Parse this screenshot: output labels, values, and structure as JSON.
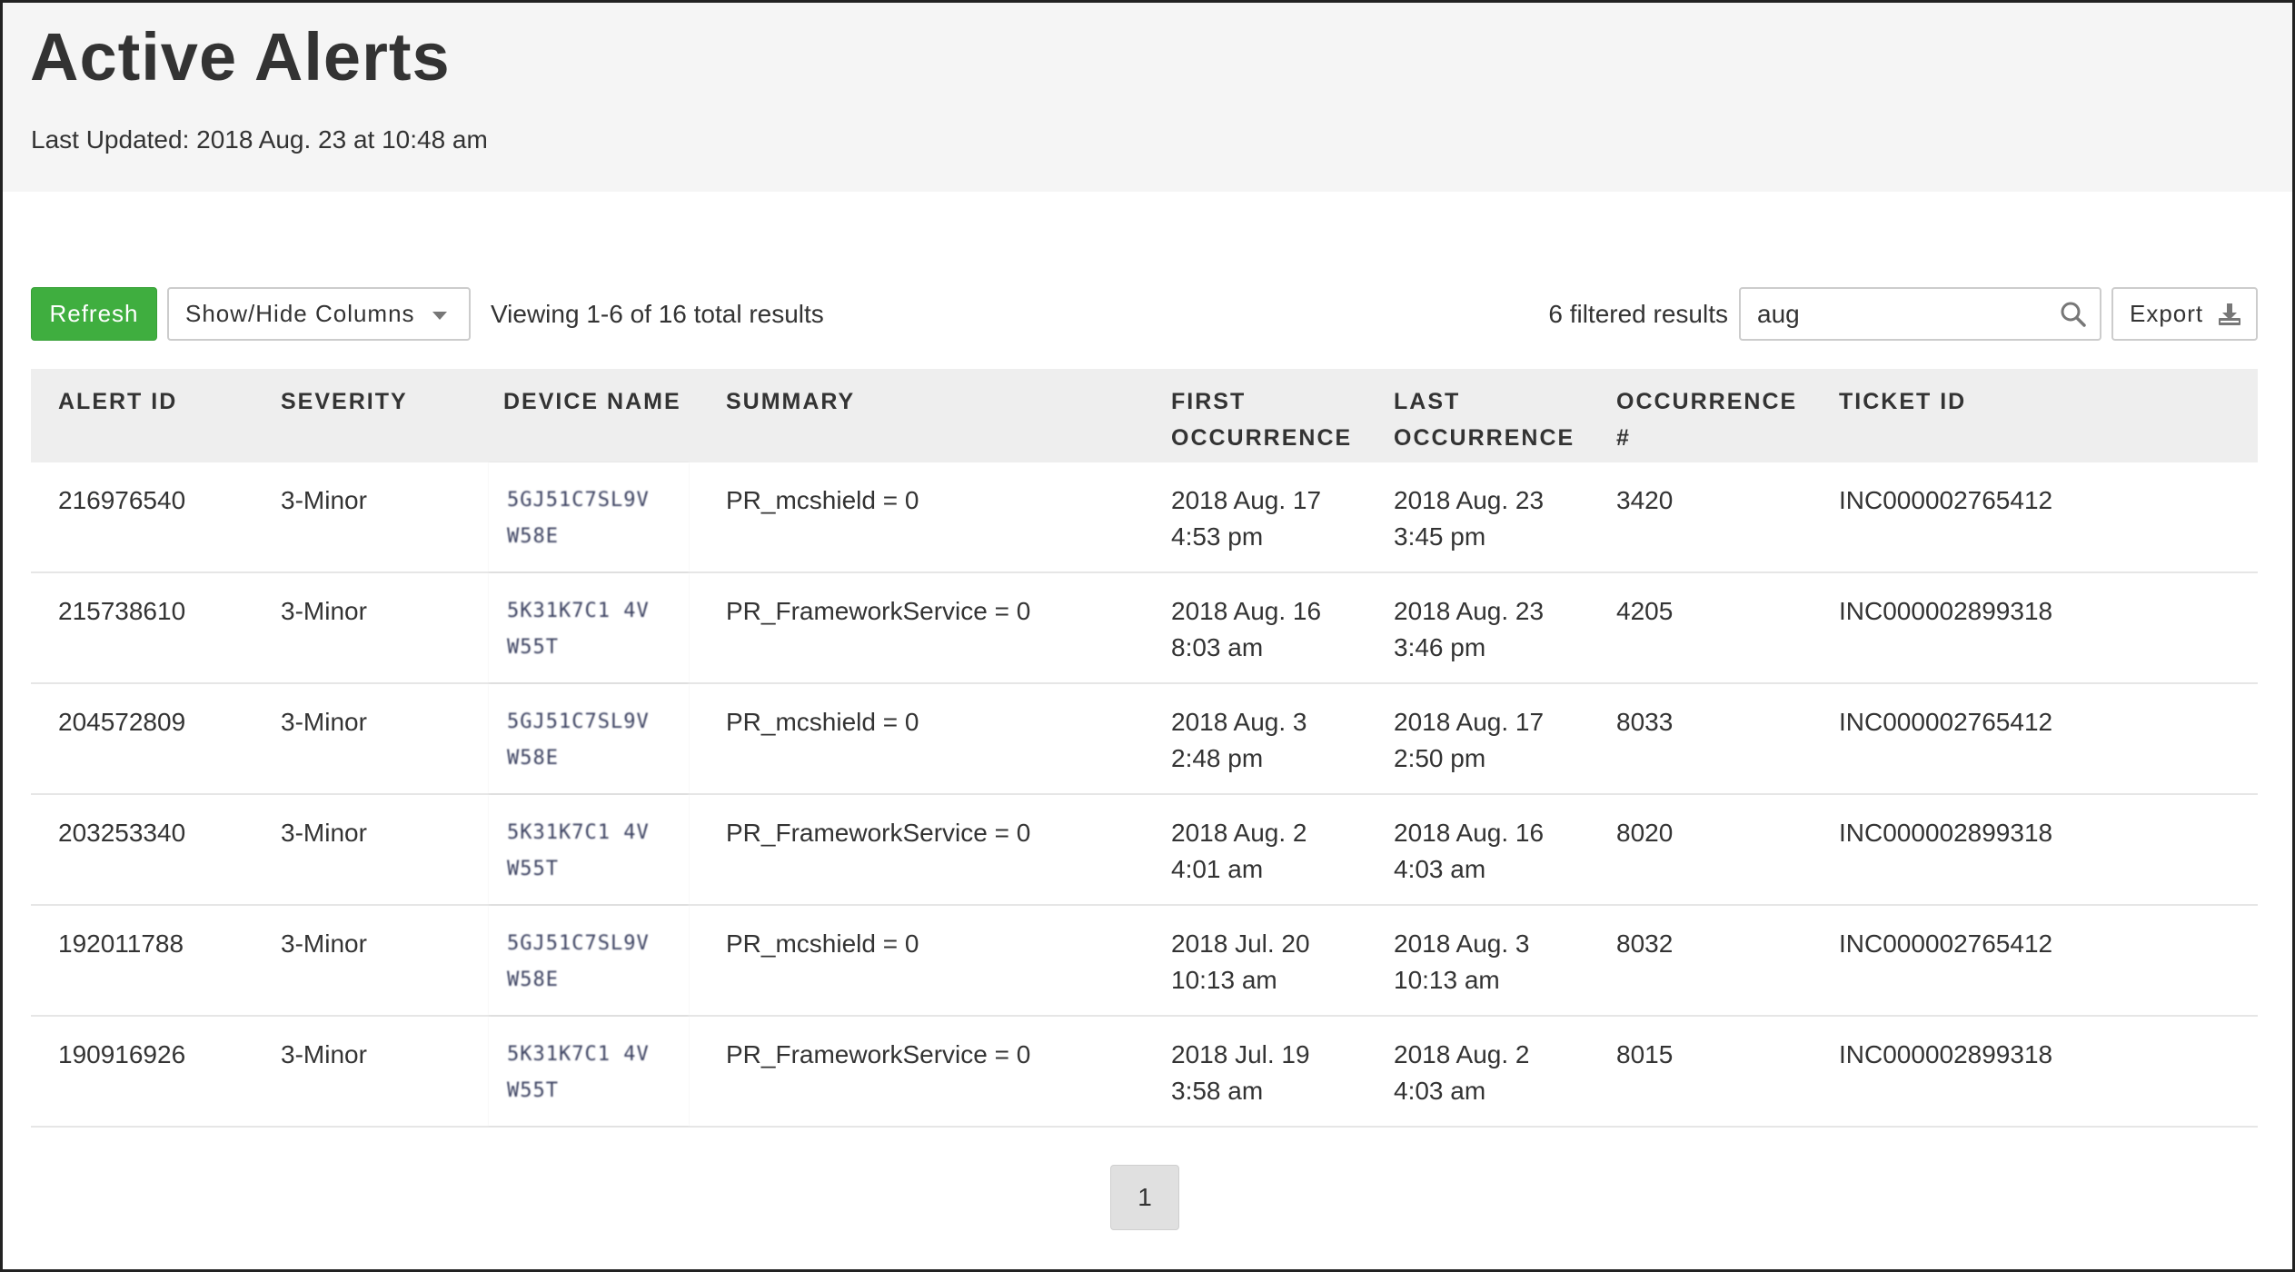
{
  "header": {
    "title": "Active Alerts",
    "last_updated": "Last Updated: 2018 Aug. 23 at 10:48 am"
  },
  "toolbar": {
    "refresh_label": "Refresh",
    "columns_label": "Show/Hide Columns",
    "viewing_text": "Viewing 1-6 of 16 total results",
    "filtered_text": "6 filtered results",
    "search_value": "aug",
    "export_label": "Export"
  },
  "colors": {
    "accent_green": "#3fae3f",
    "header_bg": "#f5f5f5",
    "table_header_bg": "#eeeeee"
  },
  "icons": {
    "search": "search-icon",
    "export": "download-icon",
    "columns_menu": "caret-down-icon"
  },
  "table": {
    "headers": {
      "alert_id": "ALERT ID",
      "severity": "SEVERITY",
      "device_name": "DEVICE NAME",
      "summary": "SUMMARY",
      "first_occurrence_1": "FIRST",
      "first_occurrence_2": "OCCURRENCE",
      "last_occurrence_1": "LAST",
      "last_occurrence_2": "OCCURRENCE",
      "occurrence_count_1": "OCCURRENCE",
      "occurrence_count_2": "#",
      "ticket_id": "TICKET ID"
    },
    "rows": [
      {
        "alert_id": "216976540",
        "severity": "3-Minor",
        "device_1": "5GJ51C7SL9V",
        "device_2": "W58E",
        "summary": "PR_mcshield = 0",
        "first_date": "2018 Aug. 17",
        "first_time": "4:53 pm",
        "last_date": "2018 Aug. 23",
        "last_time": "3:45 pm",
        "occurrence": "3420",
        "ticket": "INC000002765412"
      },
      {
        "alert_id": "215738610",
        "severity": "3-Minor",
        "device_1": "5K31K7C1 4V",
        "device_2": "W55T",
        "summary": "PR_FrameworkService = 0",
        "first_date": "2018 Aug. 16",
        "first_time": "8:03 am",
        "last_date": "2018 Aug. 23",
        "last_time": "3:46 pm",
        "occurrence": "4205",
        "ticket": "INC000002899318"
      },
      {
        "alert_id": "204572809",
        "severity": "3-Minor",
        "device_1": "5GJ51C7SL9V",
        "device_2": "W58E",
        "summary": "PR_mcshield = 0",
        "first_date": "2018 Aug. 3",
        "first_time": "2:48 pm",
        "last_date": "2018 Aug. 17",
        "last_time": "2:50 pm",
        "occurrence": "8033",
        "ticket": "INC000002765412"
      },
      {
        "alert_id": "203253340",
        "severity": "3-Minor",
        "device_1": "5K31K7C1 4V",
        "device_2": "W55T",
        "summary": "PR_FrameworkService = 0",
        "first_date": "2018 Aug. 2",
        "first_time": "4:01 am",
        "last_date": "2018 Aug. 16",
        "last_time": "4:03 am",
        "occurrence": "8020",
        "ticket": "INC000002899318"
      },
      {
        "alert_id": "192011788",
        "severity": "3-Minor",
        "device_1": "5GJ51C7SL9V",
        "device_2": "W58E",
        "summary": "PR_mcshield = 0",
        "first_date": "2018 Jul. 20",
        "first_time": "10:13 am",
        "last_date": "2018 Aug. 3",
        "last_time": "10:13 am",
        "occurrence": "8032",
        "ticket": "INC000002765412"
      },
      {
        "alert_id": "190916926",
        "severity": "3-Minor",
        "device_1": "5K31K7C1 4V",
        "device_2": "W55T",
        "summary": "PR_FrameworkService = 0",
        "first_date": "2018 Jul. 19",
        "first_time": "3:58 am",
        "last_date": "2018 Aug. 2",
        "last_time": "4:03 am",
        "occurrence": "8015",
        "ticket": "INC000002899318"
      }
    ]
  },
  "pagination": {
    "current_page": "1"
  }
}
